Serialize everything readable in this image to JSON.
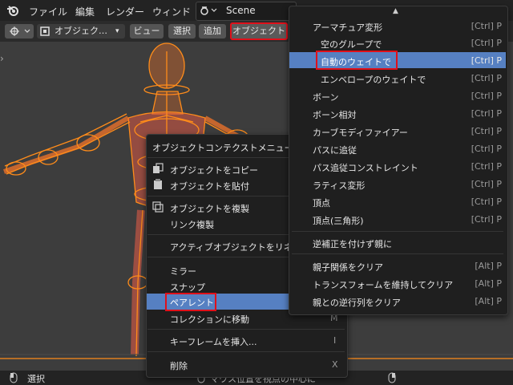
{
  "topbar": {
    "menus": [
      "ファイル",
      "編集",
      "レンダー",
      "ウィンド"
    ],
    "scene_name": "Scene"
  },
  "header": {
    "mode_label": "オブジェク…",
    "buttons": [
      "ビュー",
      "選択",
      "追加",
      "オブジェクト"
    ]
  },
  "context_menu": {
    "title": "オブジェクトコンテクストメニュー",
    "items": [
      {
        "label": "オブジェクトをコピー",
        "shortcut": ""
      },
      {
        "label": "オブジェクトを貼付",
        "shortcut": ""
      },
      {
        "label": "オブジェクトを複製",
        "shortcut": ""
      },
      {
        "label": "リンク複製",
        "shortcut": ""
      },
      {
        "label": "アクティブオブジェクトをリネ…",
        "shortcut": ""
      },
      {
        "label": "ミラー",
        "shortcut": ""
      },
      {
        "label": "スナップ",
        "shortcut": ""
      },
      {
        "label": "ペアレント",
        "shortcut": ""
      },
      {
        "label": "コレクションに移動",
        "shortcut": "M"
      },
      {
        "label": "キーフレームを挿入...",
        "shortcut": "I"
      },
      {
        "label": "削除",
        "shortcut": "X"
      }
    ]
  },
  "parent_submenu": {
    "items": [
      {
        "label": "アーマチュア変形",
        "shortcut": "[Ctrl] P"
      },
      {
        "label": "空のグループで",
        "shortcut": "[Ctrl] P"
      },
      {
        "label": "自動のウェイトで",
        "shortcut": "[Ctrl] P"
      },
      {
        "label": "エンベロープのウェイトで",
        "shortcut": "[Ctrl] P"
      },
      {
        "label": "ボーン",
        "shortcut": "[Ctrl] P"
      },
      {
        "label": "ボーン相対",
        "shortcut": "[Ctrl] P"
      },
      {
        "label": "カーブモディファイアー",
        "shortcut": "[Ctrl] P"
      },
      {
        "label": "パスに追従",
        "shortcut": "[Ctrl] P"
      },
      {
        "label": "パス追従コンストレイント",
        "shortcut": "[Ctrl] P"
      },
      {
        "label": "ラティス変形",
        "shortcut": "[Ctrl] P"
      },
      {
        "label": "頂点",
        "shortcut": "[Ctrl] P"
      },
      {
        "label": "頂点(三角形)",
        "shortcut": "[Ctrl] P"
      },
      {
        "label": "逆補正を付けず親に",
        "shortcut": ""
      },
      {
        "label": "親子関係をクリア",
        "shortcut": "[Alt] P"
      },
      {
        "label": "トランスフォームを維持してクリア",
        "shortcut": "[Alt] P"
      },
      {
        "label": "親との逆行列をクリア",
        "shortcut": "[Alt] P"
      }
    ]
  },
  "statusbar": {
    "left_label": "選択",
    "middle_label": "マウス位置を視点の中心に"
  },
  "colors": {
    "highlight": "#5680c2",
    "annotation_red": "#e0101a",
    "armature_orange": "#ff8c1a"
  }
}
